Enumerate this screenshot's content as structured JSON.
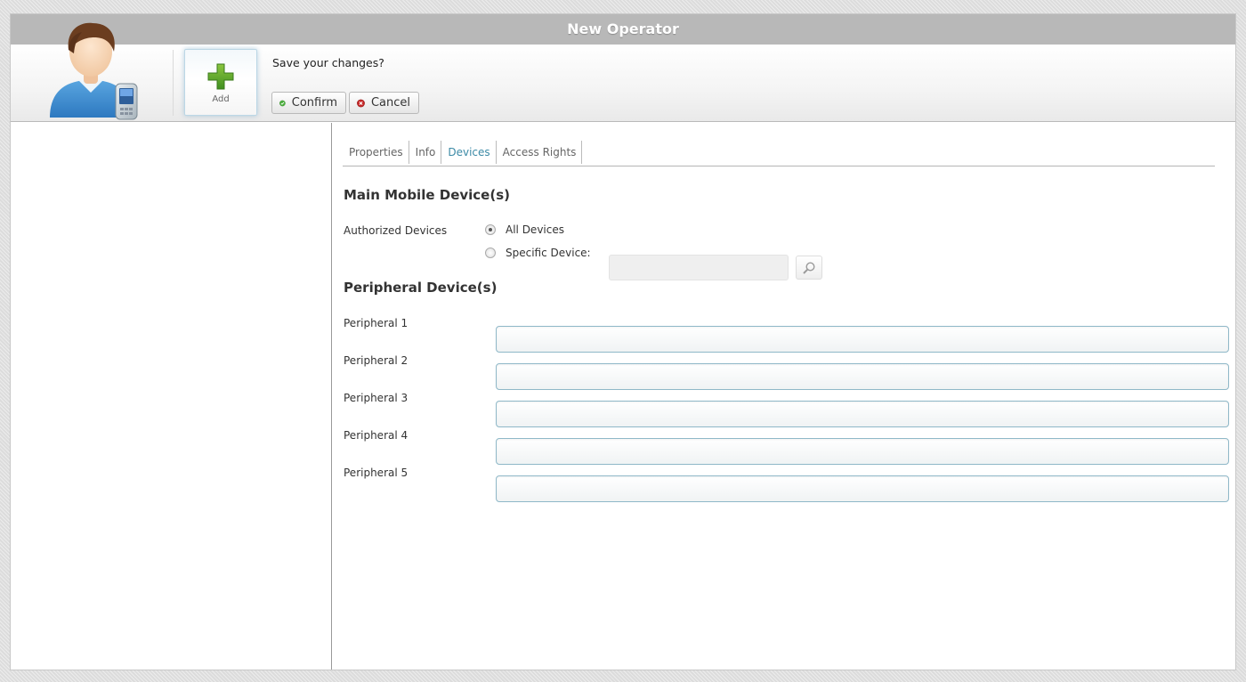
{
  "window": {
    "title": "New Operator"
  },
  "toolbar": {
    "avatar_icon": "operator-with-phone-icon",
    "add_label": "Add",
    "add_icon": "plus-icon",
    "save_message": "Save your changes?",
    "confirm_label": "Confirm",
    "confirm_icon": "check-circle-icon",
    "cancel_label": "Cancel",
    "cancel_icon": "close-circle-icon"
  },
  "tabs": [
    {
      "label": "Properties",
      "active": false
    },
    {
      "label": "Info",
      "active": false
    },
    {
      "label": "Devices",
      "active": true
    },
    {
      "label": "Access Rights",
      "active": false
    }
  ],
  "main_devices": {
    "title": "Main Mobile Device(s)",
    "authorized_label": "Authorized Devices",
    "option_all": "All Devices",
    "option_specific": "Specific Device:",
    "selected_option": "All Devices",
    "specific_value": ""
  },
  "peripherals": {
    "title": "Peripheral Device(s)",
    "items": [
      {
        "label": "Peripheral 1",
        "value": ""
      },
      {
        "label": "Peripheral 2",
        "value": ""
      },
      {
        "label": "Peripheral 3",
        "value": ""
      },
      {
        "label": "Peripheral 4",
        "value": ""
      },
      {
        "label": "Peripheral 5",
        "value": ""
      }
    ]
  },
  "colors": {
    "titlebar": "#b8b8b8",
    "active_tab": "#3c8aa6",
    "input_border": "#8fb8c8",
    "confirm_green": "#4caf3e",
    "cancel_red": "#c62828"
  }
}
